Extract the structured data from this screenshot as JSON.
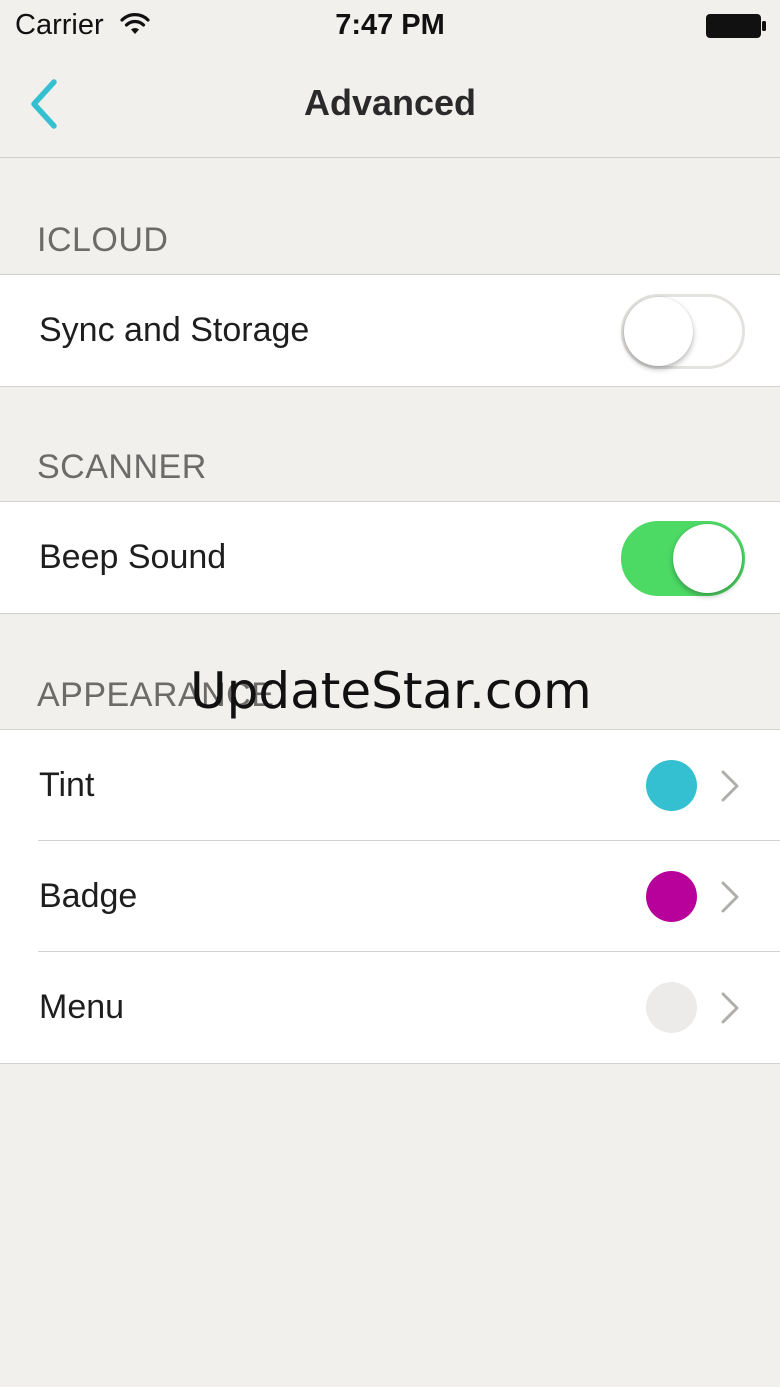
{
  "status_bar": {
    "carrier": "Carrier",
    "time": "7:47 PM",
    "icons": [
      "wifi-icon",
      "battery-icon"
    ]
  },
  "nav": {
    "title": "Advanced",
    "back_icon": "chevron-left-icon",
    "tint_color": "#35c0d2"
  },
  "sections": {
    "icloud": {
      "header": "ICLOUD",
      "rows": [
        {
          "label": "Sync and Storage",
          "toggle": false
        }
      ]
    },
    "scanner": {
      "header": "SCANNER",
      "rows": [
        {
          "label": "Beep Sound",
          "toggle": true
        }
      ]
    },
    "appearance": {
      "header": "APPEARANCE",
      "rows": [
        {
          "label": "Tint",
          "color": "#35c0d2",
          "icon": "chevron-right-icon"
        },
        {
          "label": "Badge",
          "color": "#b8009b",
          "icon": "chevron-right-icon"
        },
        {
          "label": "Menu",
          "color": "#ecebea",
          "icon": "chevron-right-icon"
        }
      ]
    }
  },
  "colors": {
    "background": "#f2f0ed",
    "toggle_on": "#4cd964",
    "chevron": "#b0aeab"
  },
  "watermark": "UpdateStar.com"
}
